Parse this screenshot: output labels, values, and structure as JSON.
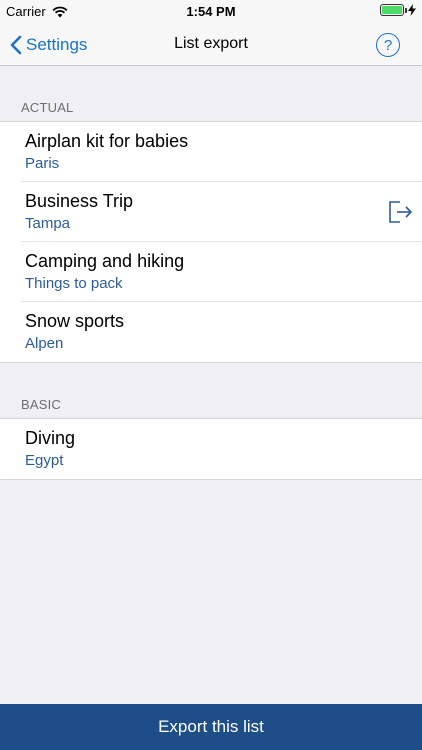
{
  "status_bar": {
    "carrier": "Carrier",
    "time": "1:54 PM"
  },
  "nav": {
    "back_label": "Settings",
    "title": "List export",
    "help_label": "?"
  },
  "sections": [
    {
      "header": "ACTUAL",
      "items": [
        {
          "title": "Airplan kit for babies",
          "subtitle": "Paris"
        },
        {
          "title": "Business Trip",
          "subtitle": "Tampa"
        },
        {
          "title": "Camping and hiking",
          "subtitle": "Things to pack"
        },
        {
          "title": "Snow sports",
          "subtitle": "Alpen"
        }
      ]
    },
    {
      "header": "BASIC",
      "items": [
        {
          "title": "Diving",
          "subtitle": "Egypt"
        }
      ]
    }
  ],
  "footer": {
    "export_label": "Export this list"
  },
  "colors": {
    "accent": "#1a73c8",
    "footer_bg": "#1e4e87",
    "subtitle": "#2b5d9a",
    "background": "#efeff4"
  }
}
